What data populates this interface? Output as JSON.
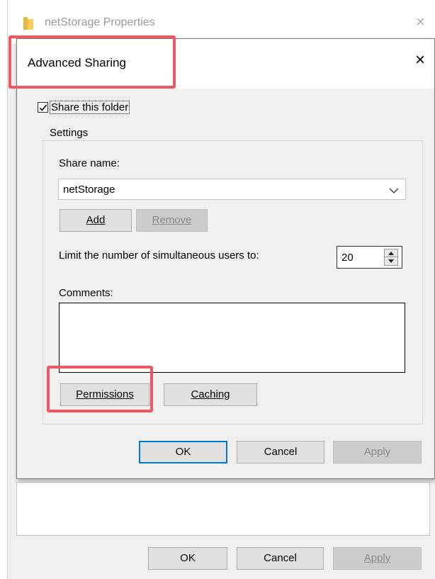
{
  "background_window": {
    "title": "netStorage Properties",
    "close_glyph": "×",
    "ok_label": "OK",
    "cancel_label": "Cancel",
    "apply_label": "Apply"
  },
  "dialog": {
    "title": "Advanced Sharing",
    "close_glyph": "×",
    "share_checkbox": {
      "label": "Share this folder",
      "checked": true
    },
    "settings_legend": "Settings",
    "share_name_label": "Share name:",
    "share_name_value": "netStorage",
    "add_label": "Add",
    "remove_label": "Remove",
    "limit_label": "Limit the number of simultaneous users to:",
    "limit_value": "20",
    "comments_label": "Comments:",
    "comments_value": "",
    "permissions_label": "Permissions",
    "caching_label": "Caching",
    "ok_label": "OK",
    "cancel_label": "Cancel",
    "apply_label": "Apply"
  },
  "icons": [
    "folder-icon",
    "close-icon",
    "checkmark-icon",
    "chevron-down-icon",
    "spinner-up-icon",
    "spinner-down-icon"
  ],
  "colors": {
    "highlight": "#ef5763",
    "default_button_border": "#0078d7",
    "dialog_background": "#f0f0f0"
  }
}
